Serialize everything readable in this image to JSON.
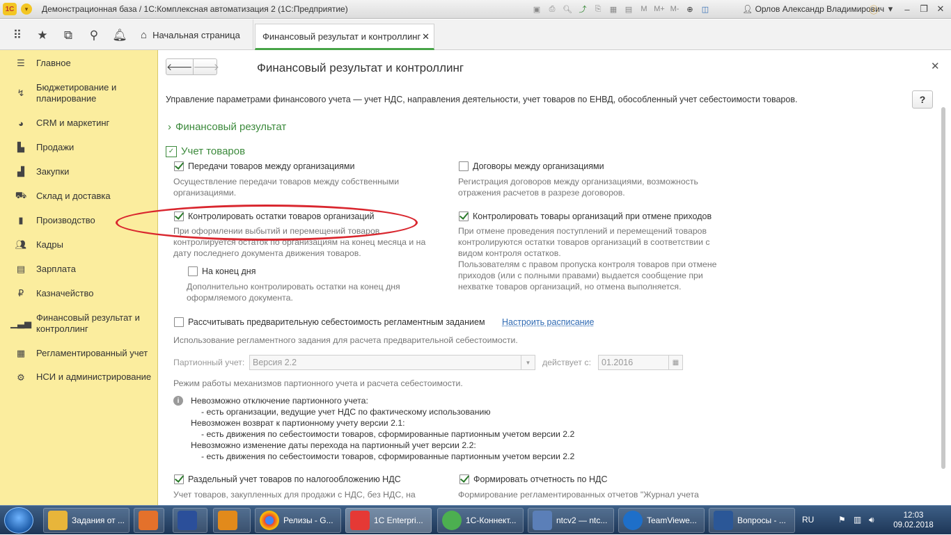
{
  "window": {
    "logo": "1С",
    "title": "Демонстрационная база / 1С:Комплексная автоматизация 2 (1С:Предприятие)",
    "user": "Орлов Александр Владимирович",
    "tool_m": "M",
    "tool_mplus": "M+",
    "tool_mminus": "M-"
  },
  "nav": {
    "home_tab": "Начальная страница",
    "active_tab": "Финансовый результат и контроллинг"
  },
  "sidebar": {
    "items": [
      {
        "label": "Главное",
        "icon": "menu-icon"
      },
      {
        "label": "Бюджетирование и планирование",
        "icon": "budget-icon"
      },
      {
        "label": "CRM и маркетинг",
        "icon": "crm-icon"
      },
      {
        "label": "Продажи",
        "icon": "sales-icon"
      },
      {
        "label": "Закупки",
        "icon": "purchases-icon"
      },
      {
        "label": "Склад и доставка",
        "icon": "warehouse-icon"
      },
      {
        "label": "Производство",
        "icon": "production-icon"
      },
      {
        "label": "Кадры",
        "icon": "hr-icon"
      },
      {
        "label": "Зарплата",
        "icon": "salary-icon"
      },
      {
        "label": "Казначейство",
        "icon": "treasury-icon"
      },
      {
        "label": "Финансовый результат и контроллинг",
        "icon": "finance-icon"
      },
      {
        "label": "Регламентированный учет",
        "icon": "accounting-icon"
      },
      {
        "label": "НСИ и администрирование",
        "icon": "admin-icon"
      }
    ]
  },
  "page": {
    "title": "Финансовый результат и контроллинг",
    "description": "Управление параметрами финансового учета — учет НДС, направления деятельности, учет товаров по ЕНВД, обособленный учет себестоимости товаров.",
    "help": "?",
    "section_financial": "Финансовый результат",
    "section_goods": "Учет товаров",
    "transfer": {
      "label": "Передачи товаров между организациями",
      "checked": true,
      "desc1": "Осуществление передачи товаров между собственными",
      "desc2": "организациями."
    },
    "contracts": {
      "label": "Договоры между организациями",
      "checked": false,
      "desc1": "Регистрация договоров между организациями, возможность",
      "desc2": "отражения расчетов  в разрезе договоров."
    },
    "control_remains": {
      "label": "Контролировать остатки товаров организаций",
      "checked": true,
      "desc1": "При оформлении выбытий и перемещений товаров",
      "desc2": "контролируется остаток по организациям на конец месяца и на",
      "desc3": "дату последнего документа движения товаров."
    },
    "control_cancel": {
      "label": "Контролировать товары организаций при отмене приходов",
      "checked": true,
      "desc1": "При отмене проведения поступлений и перемещений товаров",
      "desc2": "контролируются остатки товаров организаций в соответствии с",
      "desc3": "видом контроля остатков.",
      "desc4": "Пользователям с правом пропуска контроля товаров при отмене",
      "desc5": "приходов (или с полными правами) выдается сообщение при",
      "desc6": "нехватке товаров организаций, но отмена выполняется."
    },
    "end_of_day": {
      "label": "На конец дня",
      "checked": false,
      "desc1": "Дополнительно контролировать остатки на конец дня",
      "desc2": "оформляемого документа."
    },
    "prelim_cost": {
      "label": "Рассчитывать предварительную себестоимость регламентным заданием",
      "checked": false,
      "link": "Настроить расписание",
      "desc": "Использование регламентного задания для расчета предварительной себестоимости."
    },
    "batch": {
      "label": "Партионный учет:",
      "value": "Версия 2.2",
      "valid_from_label": "действует с:",
      "valid_from": "01.2016",
      "desc": "Режим работы механизмов партионного учета и расчета себестоимости."
    },
    "info": {
      "l1": "Невозможно отключение партионного учета:",
      "l2": "- есть организации, ведущие учет НДС по фактическому использованию",
      "l3": "Невозможен возврат к партионному учету версии 2.1:",
      "l4": "- есть движения по себестоимости товаров, сформированные партионным учетом версии 2.2",
      "l5": "Невозможно изменение даты перехода на партионный учет версии 2.2:",
      "l6": "- есть движения по себестоимости товаров, сформированные партионным учетом версии 2.2"
    },
    "separate_vat": {
      "label": "Раздельный учет товаров по налогообложению НДС",
      "checked": true,
      "desc": "Учет товаров, закупленных для продажи с НДС, без НДС, на"
    },
    "vat_report": {
      "label": "Формировать отчетность по НДС",
      "checked": true,
      "desc": "Формирование регламентированных отчетов \"Журнал учета"
    }
  },
  "taskbar": {
    "apps": [
      {
        "label": "Задания от ...",
        "color": "#e8b53a"
      },
      {
        "label": "",
        "color": "#e4712b"
      },
      {
        "label": "",
        "color": "#2b4f9a"
      },
      {
        "label": "",
        "color": "#e28a1b"
      },
      {
        "label": "Релизы - G...",
        "color": "#d64b3b"
      },
      {
        "label": "1C Enterpri...",
        "color": "#e53935"
      },
      {
        "label": "1С-Коннект...",
        "color": "#4caf50"
      },
      {
        "label": "ntcv2 — ntc...",
        "color": "#5b7fb8"
      },
      {
        "label": "TeamViewe...",
        "color": "#1e6fc9"
      },
      {
        "label": "Вопросы - ...",
        "color": "#2b5797"
      }
    ],
    "lang": "RU",
    "time": "12:03",
    "date": "09.02.2018"
  }
}
